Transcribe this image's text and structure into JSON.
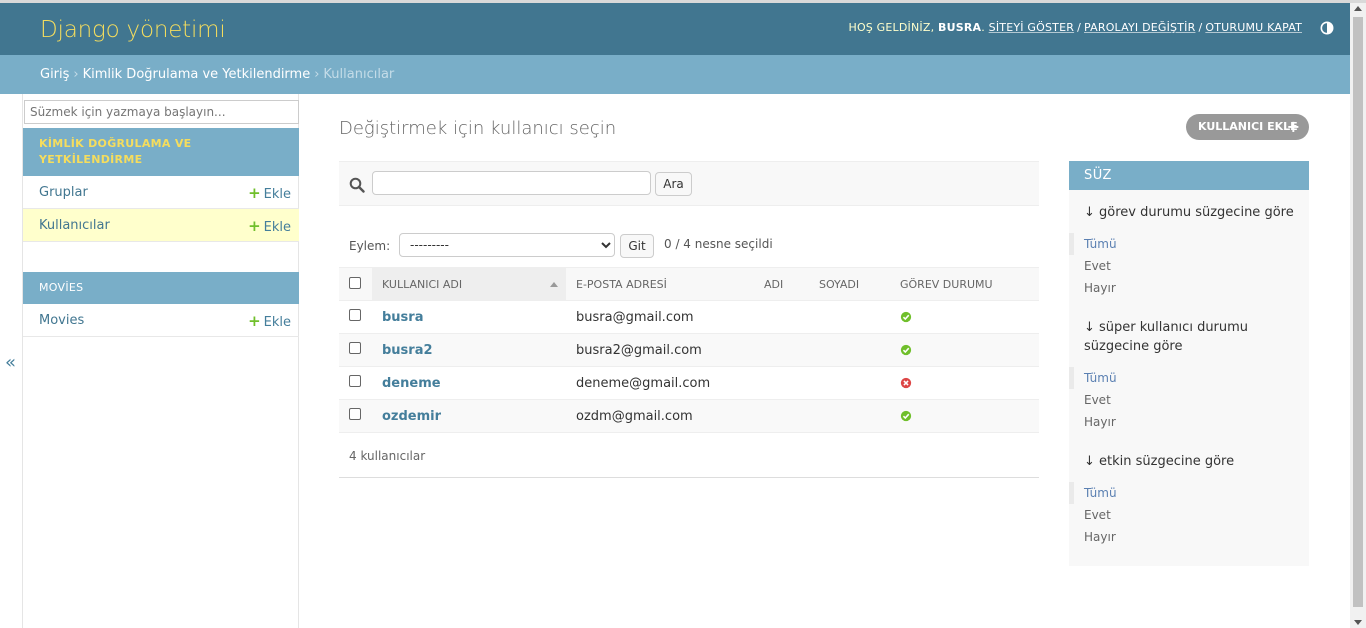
{
  "header": {
    "brand": "Django yönetimi",
    "welcome": "HOŞ GELDİNİZ,",
    "username": "BUSRA",
    "links": [
      "SİTEYİ GÖSTER",
      "PAROLAYI DEĞİŞTİR",
      "OTURUMU KAPAT"
    ]
  },
  "breadcrumbs": {
    "home": "Giriş",
    "app": "Kimlik Doğrulama ve Yetkilendirme",
    "current": "Kullanıcılar"
  },
  "sidebar": {
    "filter_placeholder": "Süzmek için yazmaya başlayın...",
    "toggle": "«",
    "apps": [
      {
        "caption": "KİMLİK DOĞRULAMA VE YETKİLENDİRME",
        "models": [
          {
            "name": "Gruplar",
            "add": "Ekle"
          },
          {
            "name": "Kullanıcılar",
            "add": "Ekle"
          }
        ]
      },
      {
        "caption": "MOVİES",
        "models": [
          {
            "name": "Movies",
            "add": "Ekle"
          }
        ]
      }
    ]
  },
  "content": {
    "title": "Değiştirmek için kullanıcı seçin",
    "add_button": "KULLANICI EKLE",
    "search_button": "Ara",
    "action_label": "Eylem:",
    "action_selected": "---------",
    "go_button": "Git",
    "selection_counter": "0 / 4 nesne seçildi",
    "columns": [
      "KULLANICI ADI",
      "E-POSTA ADRESİ",
      "ADI",
      "SOYADI",
      "GÖREV DURUMU"
    ],
    "rows": [
      {
        "username": "busra",
        "email": "busra@gmail.com",
        "first": "",
        "last": "",
        "staff": true
      },
      {
        "username": "busra2",
        "email": "busra2@gmail.com",
        "first": "",
        "last": "",
        "staff": true
      },
      {
        "username": "deneme",
        "email": "deneme@gmail.com",
        "first": "",
        "last": "",
        "staff": false
      },
      {
        "username": "ozdemir",
        "email": "ozdm@gmail.com",
        "first": "",
        "last": "",
        "staff": true
      }
    ],
    "paginator": "4 kullanıcılar"
  },
  "filter": {
    "title": "SÜZ",
    "groups": [
      {
        "title": "↓ görev durumu süzgecine göre",
        "options": [
          "Tümü",
          "Evet",
          "Hayır"
        ],
        "selected": 0
      },
      {
        "title": "↓ süper kullanıcı durumu süzgecine göre",
        "options": [
          "Tümü",
          "Evet",
          "Hayır"
        ],
        "selected": 0
      },
      {
        "title": "↓ etkin süzgecine göre",
        "options": [
          "Tümü",
          "Evet",
          "Hayır"
        ],
        "selected": 0
      }
    ]
  },
  "colors": {
    "header_bg": "#417690",
    "breadcrumb_bg": "#79aec8",
    "brand": "#f5dd5d",
    "link": "#447e9b",
    "success": "#70bf2b",
    "error": "#dd4646"
  }
}
